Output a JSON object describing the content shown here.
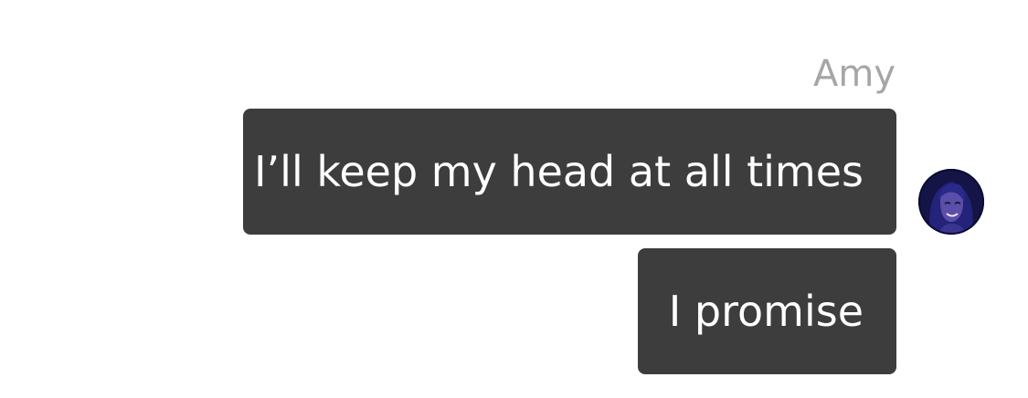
{
  "conversation": {
    "sender": "Amy",
    "messages": [
      {
        "text": "I’ll keep my head at all times"
      },
      {
        "text": "I promise"
      }
    ],
    "avatar": {
      "icon": "character-avatar-icon",
      "colors": {
        "background": "#141447",
        "hair": "#2a2a8a",
        "skin": "#5b4ea8"
      }
    }
  },
  "colors": {
    "bubble_bg": "#3d3d3d",
    "bubble_text": "#ffffff",
    "sender_name": "#a6a6a6",
    "page_bg": "#ffffff"
  }
}
